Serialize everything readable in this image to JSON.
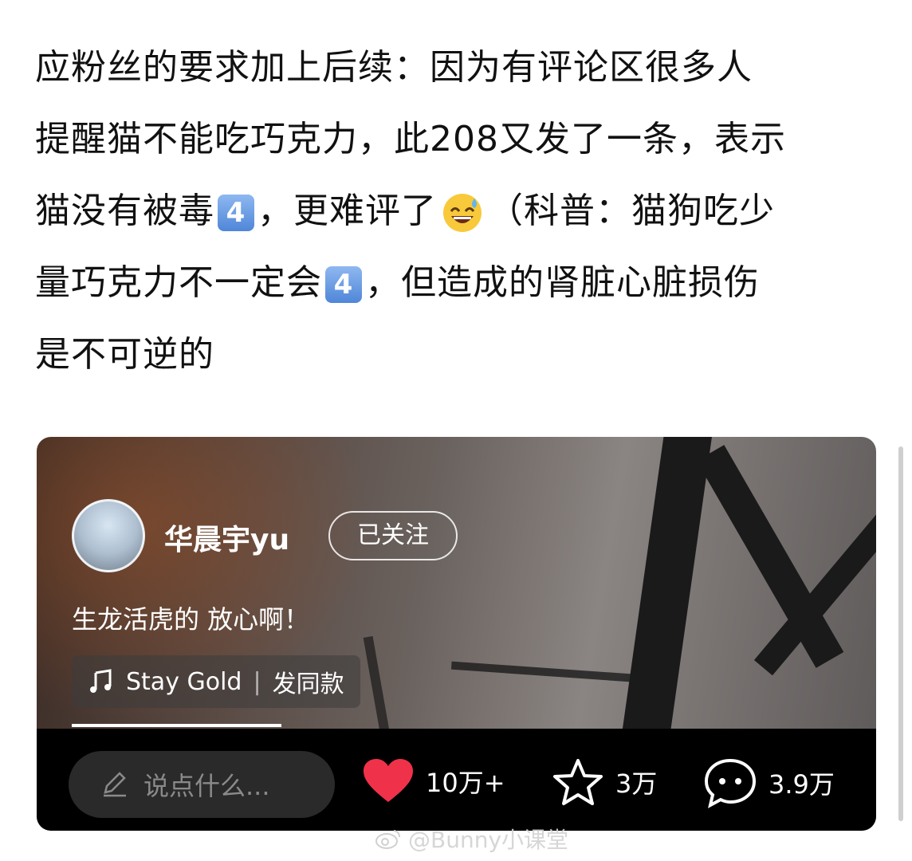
{
  "post": {
    "lines": [
      [
        "应粉丝的要求加上后续：因为有评论区很多人"
      ],
      [
        "提醒猫不能吃巧克力，此208又发了一条，表示"
      ],
      [
        "猫没有被毒",
        "4️⃣",
        "，更难评了",
        "😅",
        "（科普：猫狗吃少"
      ],
      [
        "量巧克力不一定会",
        "4️⃣",
        "，但造成的肾脏心脏损伤"
      ],
      [
        "是不可逆的"
      ]
    ]
  },
  "video": {
    "username": "华晨宇yu",
    "follow_label": "已关注",
    "caption": "生龙活虎的 放心啊！",
    "music": {
      "title": "Stay Gold",
      "separator": "|",
      "action": "发同款",
      "icon": "music-note-icon"
    },
    "progress": 0.25
  },
  "bottom_bar": {
    "comment_placeholder": "说点什么...",
    "likes": "10万+",
    "favorites": "3万",
    "comments": "3.9万"
  },
  "watermark": {
    "text": "@Bunny小课堂"
  },
  "colors": {
    "heart": "#f0314a",
    "badge": "#5b8fdc"
  }
}
